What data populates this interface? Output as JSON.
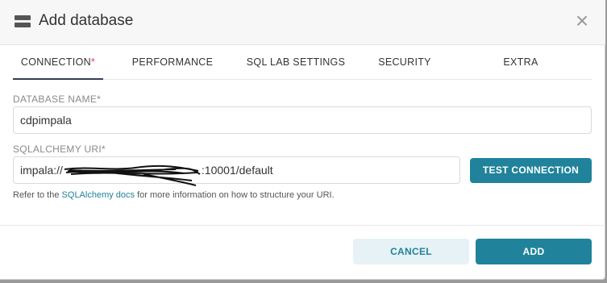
{
  "dialog": {
    "title": "Add database",
    "close_icon": "close-icon",
    "header_icon": "database-icon"
  },
  "tabs": [
    {
      "label": "CONNECTION",
      "required_marker": "*",
      "active": true
    },
    {
      "label": "PERFORMANCE"
    },
    {
      "label": "SQL LAB SETTINGS"
    },
    {
      "label": "SECURITY"
    },
    {
      "label": "EXTRA"
    }
  ],
  "form": {
    "database_name": {
      "label": "DATABASE NAME*",
      "value": "cdpimpala"
    },
    "sqlalchemy_uri": {
      "label": "SQLALCHEMY URI*",
      "value_prefix": "impala://",
      "value_suffix": ":10001/default"
    },
    "test_connection_label": "TEST CONNECTION",
    "help": {
      "prefix": "Refer to the ",
      "link": "SQLAlchemy docs",
      "suffix": " for more information on how to structure your URI."
    }
  },
  "footer": {
    "cancel_label": "CANCEL",
    "add_label": "ADD"
  },
  "colors": {
    "primary": "#20839b",
    "primary_light": "#e7f2f6",
    "required": "#e04355",
    "tab_underline": "#324054"
  }
}
